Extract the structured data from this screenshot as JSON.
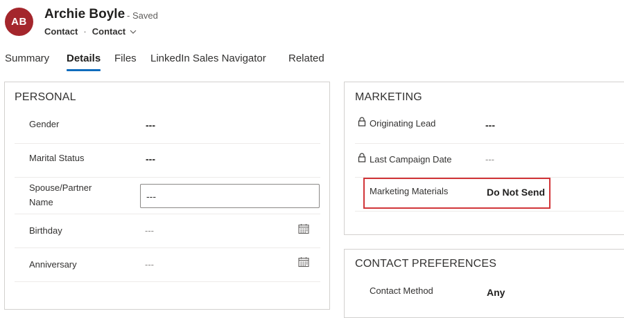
{
  "header": {
    "avatar_initials": "AB",
    "record_name": "Archie Boyle",
    "save_status": "- Saved",
    "entity_name": "Contact",
    "form_name": "Contact",
    "avatar_color": "#a4262c"
  },
  "tabs": [
    {
      "label": "Summary",
      "active": false
    },
    {
      "label": "Details",
      "active": true
    },
    {
      "label": "Files",
      "active": false
    },
    {
      "label": "LinkedIn Sales Navigator",
      "active": false
    },
    {
      "label": "Related",
      "active": false
    }
  ],
  "personal": {
    "title": "PERSONAL",
    "fields": {
      "gender": {
        "label": "Gender",
        "value": "---"
      },
      "marital_status": {
        "label": "Marital Status",
        "value": "---"
      },
      "spouse_line1": "Spouse/Partner",
      "spouse_line2": "Name",
      "spouse_value": "---",
      "birthday": {
        "label": "Birthday",
        "value": "---"
      },
      "anniversary": {
        "label": "Anniversary",
        "value": "---"
      }
    }
  },
  "marketing": {
    "title": "MARKETING",
    "fields": {
      "originating_lead": {
        "label": "Originating Lead",
        "value": "---"
      },
      "last_campaign_date": {
        "label": "Last Campaign Date",
        "value": "---"
      },
      "marketing_materials": {
        "label": "Marketing Materials",
        "value": "Do Not Send"
      }
    }
  },
  "contact_preferences": {
    "title": "CONTACT PREFERENCES",
    "fields": {
      "contact_method": {
        "label": "Contact Method",
        "value": "Any"
      }
    }
  },
  "icons": {
    "lock": "lock-icon",
    "calendar": "calendar-icon",
    "chevron": "chevron-down-icon"
  },
  "colors": {
    "accent": "#0f6cbd",
    "highlight": "#d13438"
  }
}
